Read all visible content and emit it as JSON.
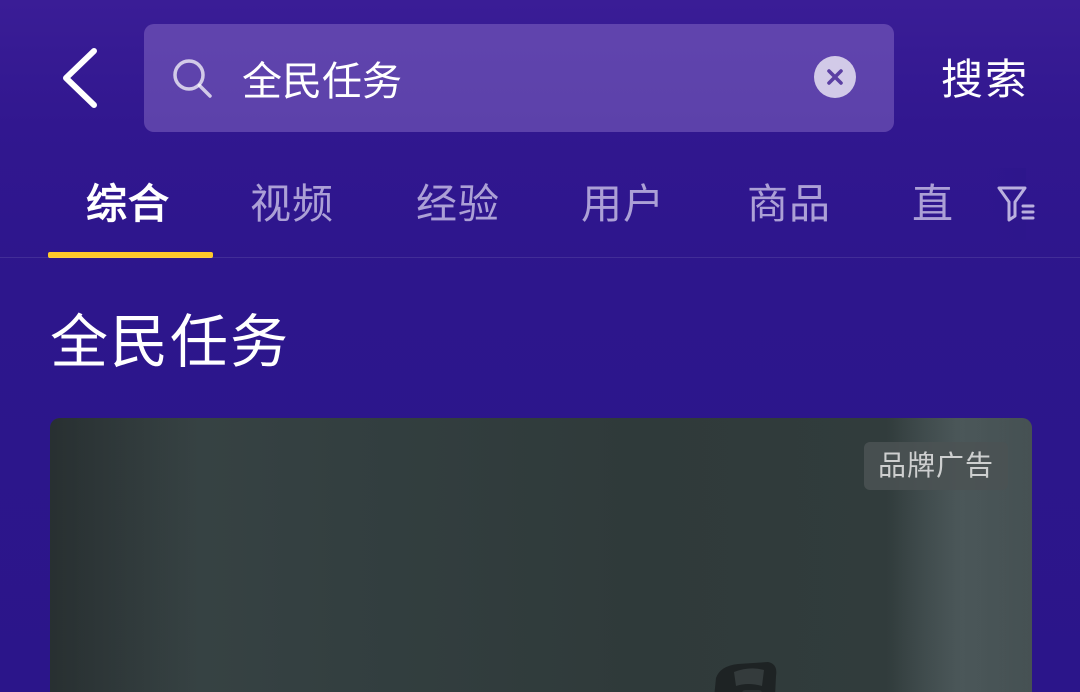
{
  "header": {
    "search": {
      "value": "全民任务",
      "placeholder": ""
    },
    "search_button_label": "搜索",
    "icons": {
      "back": "chevron-left-icon",
      "search": "search-icon",
      "clear": "close-circle-icon"
    }
  },
  "tabs": [
    {
      "label": "综合",
      "active": true
    },
    {
      "label": "视频",
      "active": false
    },
    {
      "label": "经验",
      "active": false
    },
    {
      "label": "用户",
      "active": false
    },
    {
      "label": "商品",
      "active": false
    },
    {
      "label": "直",
      "active": false
    }
  ],
  "filter_icon": "filter-icon",
  "section": {
    "title": "全民任务"
  },
  "ad": {
    "badge": "品牌广告"
  },
  "colors": {
    "background": "#2e168f",
    "tab_underline": "#ffc82a",
    "text_primary": "#ffffff",
    "text_muted": "#c9c2e8"
  }
}
